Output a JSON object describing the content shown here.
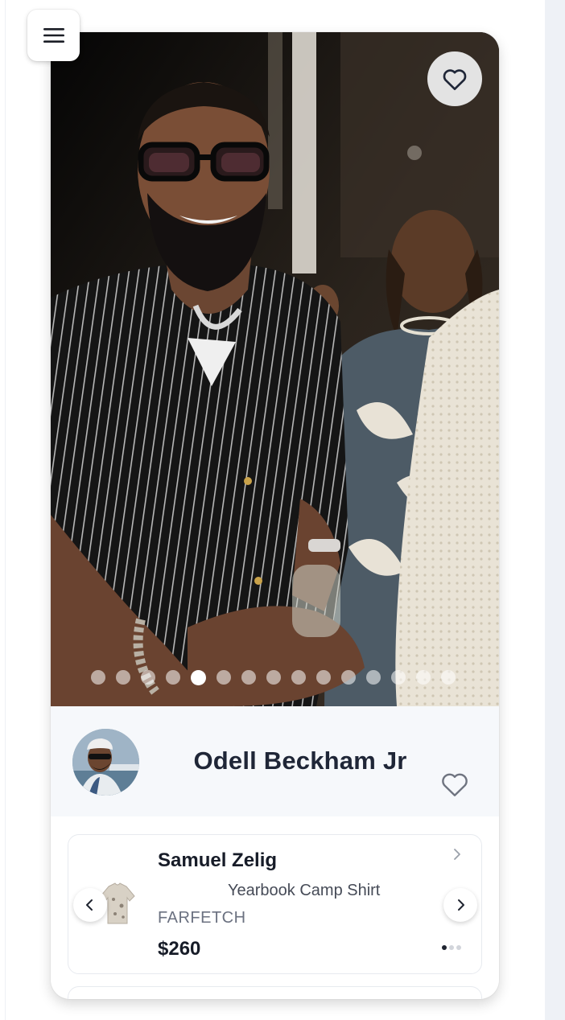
{
  "header": {
    "menu_icon": "hamburger-icon"
  },
  "photo": {
    "favorite_icon": "heart-outline-icon",
    "carousel": {
      "total_slides": 15,
      "active_index": 4
    }
  },
  "profile": {
    "name": "Odell Beckham Jr",
    "favorite_icon": "heart-outline-icon"
  },
  "product": {
    "brand": "Samuel Zelig",
    "name": "Yearbook Camp Shirt",
    "retailer": "FARFETCH",
    "price": "$260",
    "prev_icon": "chevron-left-icon",
    "next_icon": "chevron-right-icon",
    "detail_icon": "chevron-right-icon",
    "pager": {
      "total": 3,
      "active_index": 0
    }
  },
  "colors": {
    "title_text": "#1f2637",
    "heart_stroke": "#1f2637",
    "profile_bg": "#f6f8fb"
  }
}
